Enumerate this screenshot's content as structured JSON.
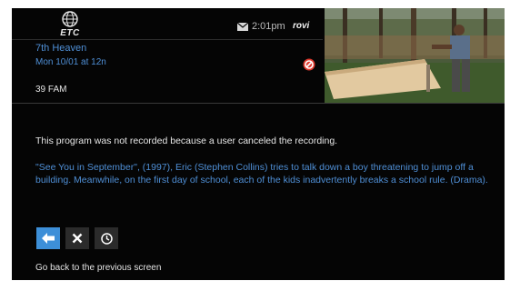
{
  "header": {
    "logo_text": "ETC",
    "time": "2:01pm",
    "brand": "rovi"
  },
  "program": {
    "title": "7th Heaven",
    "airing": "Mon 10/01 at 12n",
    "channel": "39 FAM"
  },
  "message": "This program was not recorded because a user canceled the recording.",
  "description": "\"See You in September\", (1997), Eric (Stephen Collins) tries to talk down a boy threatening to jump off a building. Meanwhile, on the first day of school, each of the kids inadvertently breaks a school rule. (Drama).",
  "actions": {
    "items": [
      "back-arrow-icon",
      "close-icon",
      "clock-icon"
    ]
  },
  "hint": "Go back to the previous screen",
  "colors": {
    "accent": "#3d8fd8",
    "text_blue": "#4f8fd6",
    "background": "#050505",
    "no_record": "#e03a2e"
  }
}
